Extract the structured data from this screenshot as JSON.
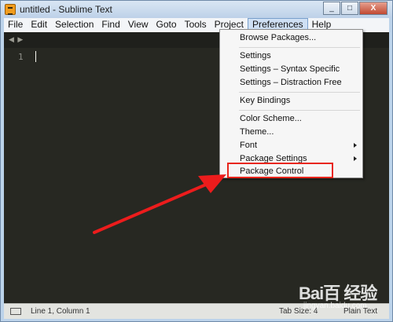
{
  "window": {
    "title": "untitled - Sublime Text",
    "controls": [
      "_",
      "□",
      "X"
    ]
  },
  "menubar": {
    "items": [
      "File",
      "Edit",
      "Selection",
      "Find",
      "View",
      "Goto",
      "Tools",
      "Project",
      "Preferences",
      "Help"
    ],
    "active": "Preferences"
  },
  "editor": {
    "line_number": "1",
    "tab_arrows": "◀ ▶",
    "background": "#272822"
  },
  "preferences_menu": {
    "items": [
      "Browse Packages...",
      "Settings",
      "Settings – Syntax Specific",
      "Settings – Distraction Free",
      "Key Bindings",
      "Color Scheme...",
      "Theme...",
      "Font",
      "Package Settings",
      "Package Control"
    ],
    "submenus": [
      "Font",
      "Package Settings"
    ],
    "highlighted": "Package Control",
    "highlight_color": "#e8261c"
  },
  "statusbar": {
    "position": "Line 1, Column 1",
    "tab_size": "Tab Size: 4",
    "syntax": "Plain Text"
  },
  "watermark": {
    "logo": "Bai百 经验",
    "url": "jingyan.baidu.com"
  }
}
